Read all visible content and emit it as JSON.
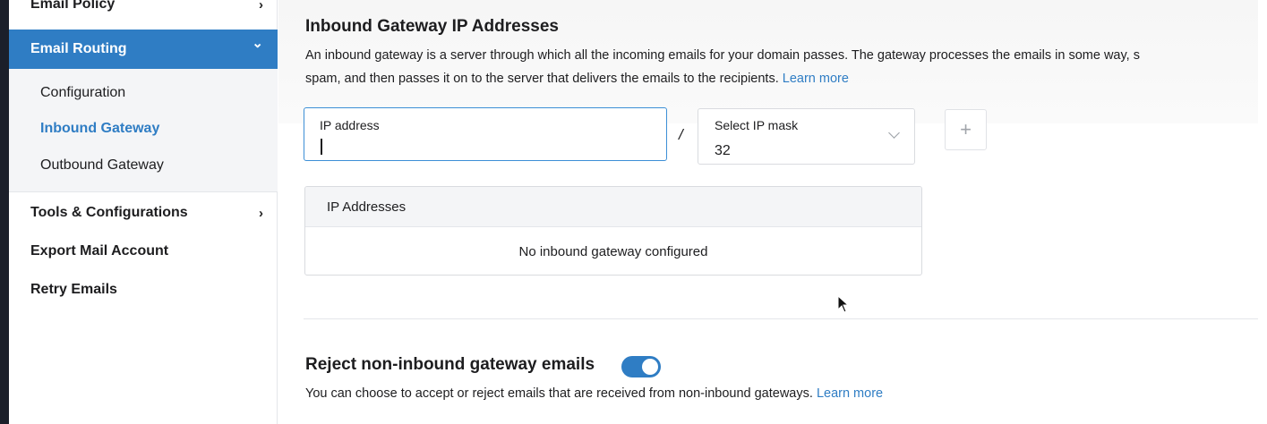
{
  "sidebar": {
    "email_policy": "Email Policy",
    "email_routing": "Email Routing",
    "routing_items": [
      "Configuration",
      "Inbound Gateway",
      "Outbound Gateway"
    ],
    "tools": "Tools & Configurations",
    "export": "Export Mail Account",
    "retry": "Retry Emails",
    "chevron_right": "›",
    "chevron_down": "⌄"
  },
  "main": {
    "title": "Inbound Gateway IP Addresses",
    "desc_line1": "An inbound gateway is a server through which all the incoming emails for your domain passes. The gateway processes the emails in some way, s",
    "desc_line2": "spam, and then passes it on to the server that delivers the emails to the recipients.",
    "learn_more": "Learn more",
    "ip_field": {
      "label": "IP address",
      "value": ""
    },
    "slash": "/",
    "mask_select": {
      "label": "Select IP mask",
      "value": "32"
    },
    "add_button": "+",
    "table": {
      "header": "IP Addresses",
      "empty": "No inbound gateway configured"
    },
    "reject": {
      "title": "Reject non-inbound gateway emails",
      "enabled": true,
      "desc": "You can choose to accept or reject emails that are received from non-inbound gateways.",
      "learn_more": "Learn more"
    }
  },
  "colors": {
    "accent": "#2f7dc4",
    "left_strip": "#1b1f2a"
  },
  "icons": {
    "cursor": "mouse-pointer-icon",
    "mask_dropdown": "chevron-down-icon",
    "add": "plus-icon"
  }
}
